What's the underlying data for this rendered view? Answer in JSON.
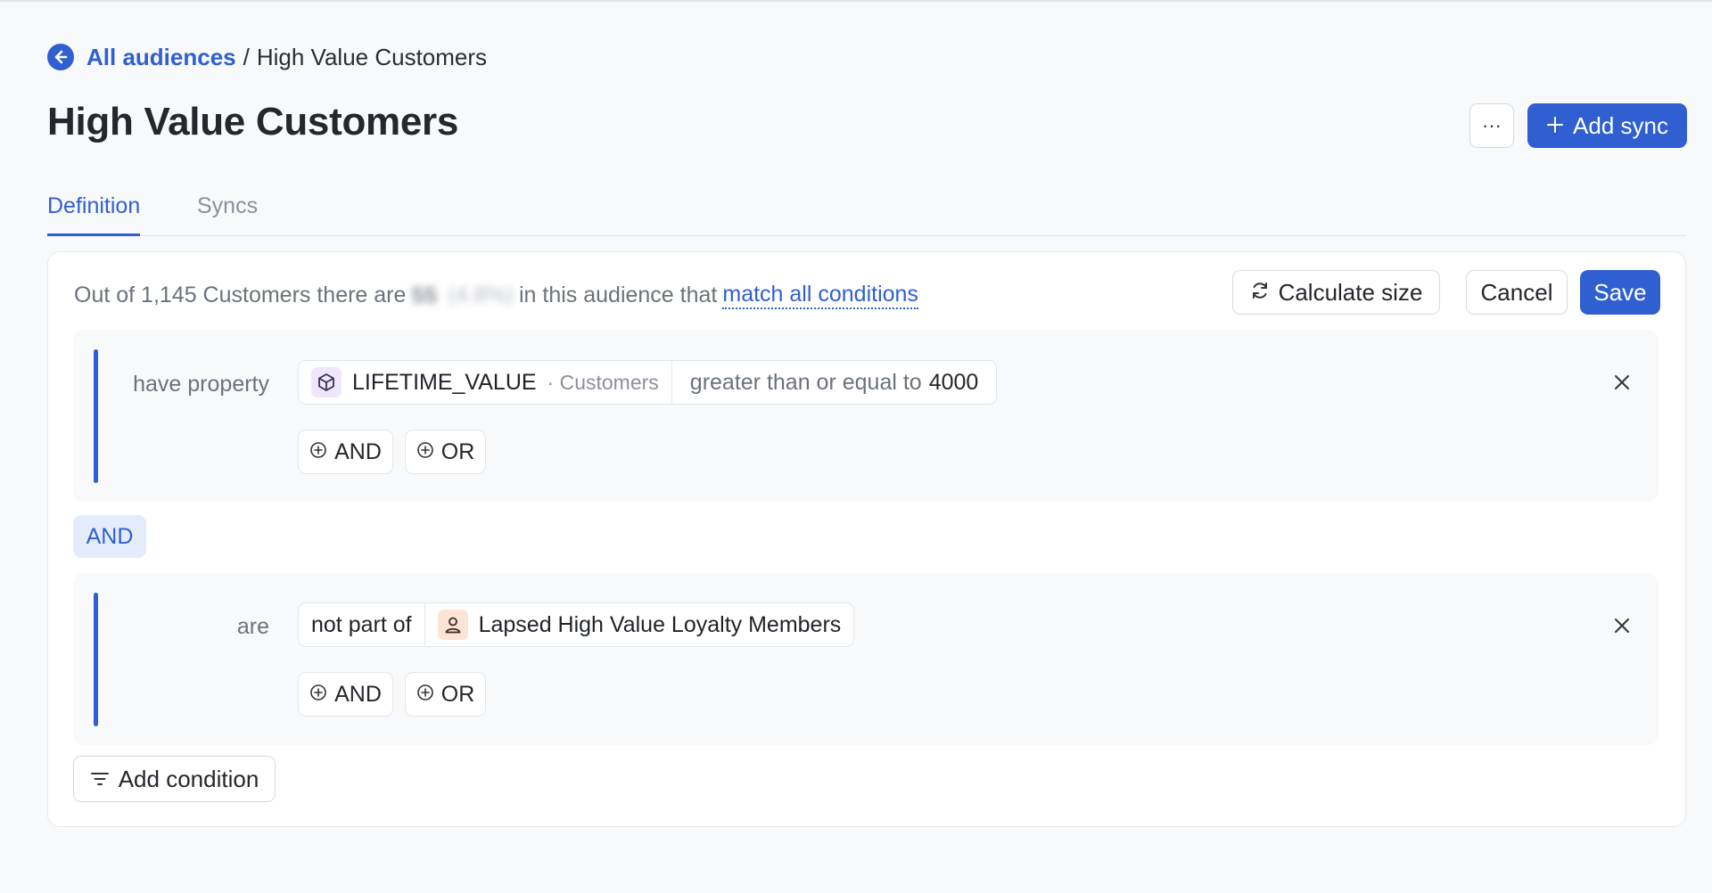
{
  "breadcrumb": {
    "back_icon": "arrow-left-circle-icon",
    "parent": "All audiences",
    "separator": "/",
    "current": "High Value Customers"
  },
  "header": {
    "title": "High Value Customers",
    "more_label": "···",
    "add_sync_label": "Add sync"
  },
  "tabs": [
    {
      "label": "Definition",
      "active": true
    },
    {
      "label": "Syncs",
      "active": false
    }
  ],
  "summary": {
    "prefix": "Out of 1,145 Customers there are",
    "count": "55",
    "percent": "(4.8%)",
    "middle": "in this audience that",
    "match_link": "match all conditions"
  },
  "actions": {
    "calculate_label": "Calculate size",
    "cancel_label": "Cancel",
    "save_label": "Save"
  },
  "conditions": [
    {
      "label": "have property",
      "property": "LIFETIME_VALUE",
      "source": "· Customers",
      "operator": "greater than or equal to",
      "value": "4000",
      "and_label": "AND",
      "or_label": "OR"
    },
    {
      "label": "are",
      "operator": "not part of",
      "audience": "Lapsed High Value Loyalty Members",
      "and_label": "AND",
      "or_label": "OR"
    }
  ],
  "joiner": "AND",
  "add_condition_label": "Add condition",
  "colors": {
    "accent": "#2f5fd0",
    "background": "#f8f9fb",
    "joiner_bg": "#e4ecfb"
  }
}
